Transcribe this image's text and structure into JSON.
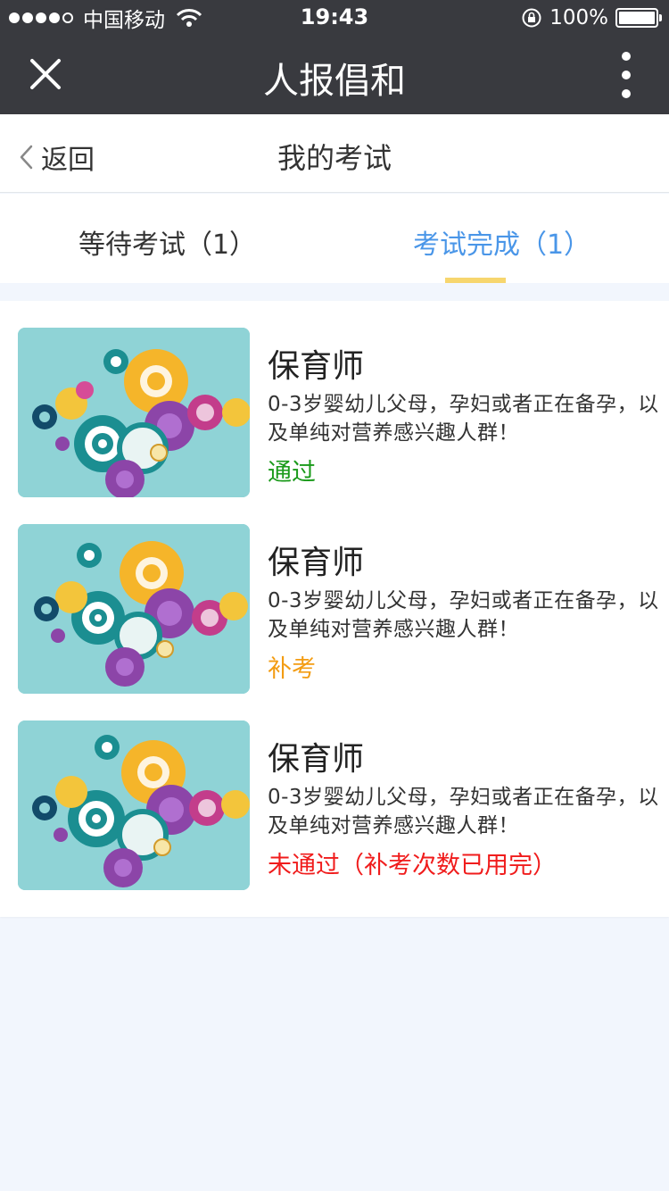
{
  "status_bar": {
    "carrier": "中国移动",
    "time": "19:43",
    "battery": "100%"
  },
  "titlebar": {
    "title": "人报倡和"
  },
  "header": {
    "back_label": "返回",
    "title": "我的考试"
  },
  "tabs": [
    {
      "label": "等待考试（1）",
      "active": false
    },
    {
      "label": "考试完成（1）",
      "active": true
    }
  ],
  "colors": {
    "topbar": "#393a3f",
    "tab_active": "#4a96e8",
    "tab_indicator": "#f7d66e",
    "status_pass": "#1a9a1a",
    "status_retake": "#f39c12",
    "status_fail": "#f01c1c"
  },
  "exams": [
    {
      "name": "保育师",
      "description": "0-3岁婴幼儿父母，孕妇或者正在备孕，以及单纯对营养感兴趣人群！",
      "status": "通过",
      "status_color": "#1a9a1a"
    },
    {
      "name": "保育师",
      "description": "0-3岁婴幼儿父母，孕妇或者正在备孕，以及单纯对营养感兴趣人群！",
      "status": "补考",
      "status_color": "#f39c12"
    },
    {
      "name": "保育师",
      "description": "0-3岁婴幼儿父母，孕妇或者正在备孕，以及单纯对营养感兴趣人群！",
      "status": "未通过（补考次数已用完）",
      "status_color": "#f01c1c"
    }
  ]
}
